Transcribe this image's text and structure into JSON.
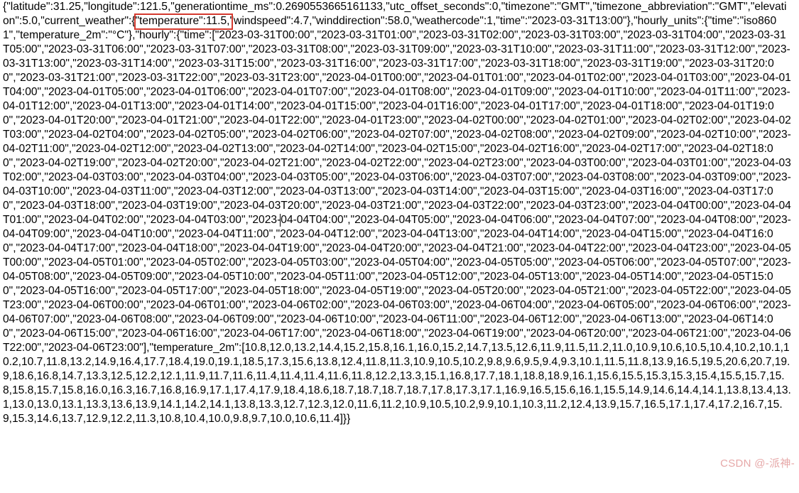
{
  "latitude": 31.25,
  "longitude": 121.5,
  "generationtime_ms": 0.2690553665161133,
  "utc_offset_seconds": 0,
  "timezone": "GMT",
  "timezone_abbreviation": "GMT",
  "elevation": 5.0,
  "current_weather": {
    "temperature": 11.5,
    "windspeed": 4.7,
    "winddirection": 58.0,
    "weathercode": 1,
    "time": "2023-03-31T13:00"
  },
  "hourly_units": {
    "time": "iso8601",
    "temperature_2m": "°C"
  },
  "hourly": {
    "time": [
      "2023-03-31T00:00",
      "2023-03-31T01:00",
      "2023-03-31T02:00",
      "2023-03-31T03:00",
      "2023-03-31T04:00",
      "2023-03-31T05:00",
      "2023-03-31T06:00",
      "2023-03-31T07:00",
      "2023-03-31T08:00",
      "2023-03-31T09:00",
      "2023-03-31T10:00",
      "2023-03-31T11:00",
      "2023-03-31T12:00",
      "2023-03-31T13:00",
      "2023-03-31T14:00",
      "2023-03-31T15:00",
      "2023-03-31T16:00",
      "2023-03-31T17:00",
      "2023-03-31T18:00",
      "2023-03-31T19:00",
      "2023-03-31T20:00",
      "2023-03-31T21:00",
      "2023-03-31T22:00",
      "2023-03-31T23:00",
      "2023-04-01T00:00",
      "2023-04-01T01:00",
      "2023-04-01T02:00",
      "2023-04-01T03:00",
      "2023-04-01T04:00",
      "2023-04-01T05:00",
      "2023-04-01T06:00",
      "2023-04-01T07:00",
      "2023-04-01T08:00",
      "2023-04-01T09:00",
      "2023-04-01T10:00",
      "2023-04-01T11:00",
      "2023-04-01T12:00",
      "2023-04-01T13:00",
      "2023-04-01T14:00",
      "2023-04-01T15:00",
      "2023-04-01T16:00",
      "2023-04-01T17:00",
      "2023-04-01T18:00",
      "2023-04-01T19:00",
      "2023-04-01T20:00",
      "2023-04-01T21:00",
      "2023-04-01T22:00",
      "2023-04-01T23:00",
      "2023-04-02T00:00",
      "2023-04-02T01:00",
      "2023-04-02T02:00",
      "2023-04-02T03:00",
      "2023-04-02T04:00",
      "2023-04-02T05:00",
      "2023-04-02T06:00",
      "2023-04-02T07:00",
      "2023-04-02T08:00",
      "2023-04-02T09:00",
      "2023-04-02T10:00",
      "2023-04-02T11:00",
      "2023-04-02T12:00",
      "2023-04-02T13:00",
      "2023-04-02T14:00",
      "2023-04-02T15:00",
      "2023-04-02T16:00",
      "2023-04-02T17:00",
      "2023-04-02T18:00",
      "2023-04-02T19:00",
      "2023-04-02T20:00",
      "2023-04-02T21:00",
      "2023-04-02T22:00",
      "2023-04-02T23:00",
      "2023-04-03T00:00",
      "2023-04-03T01:00",
      "2023-04-03T02:00",
      "2023-04-03T03:00",
      "2023-04-03T04:00",
      "2023-04-03T05:00",
      "2023-04-03T06:00",
      "2023-04-03T07:00",
      "2023-04-03T08:00",
      "2023-04-03T09:00",
      "2023-04-03T10:00",
      "2023-04-03T11:00",
      "2023-04-03T12:00",
      "2023-04-03T13:00",
      "2023-04-03T14:00",
      "2023-04-03T15:00",
      "2023-04-03T16:00",
      "2023-04-03T17:00",
      "2023-04-03T18:00",
      "2023-04-03T19:00",
      "2023-04-03T20:00",
      "2023-04-03T21:00",
      "2023-04-03T22:00",
      "2023-04-03T23:00",
      "2023-04-04T00:00",
      "2023-04-04T01:00",
      "2023-04-04T02:00",
      "2023-04-04T03:00",
      "2023-04-04T04:00",
      "2023-04-04T05:00",
      "2023-04-04T06:00",
      "2023-04-04T07:00",
      "2023-04-04T08:00",
      "2023-04-04T09:00",
      "2023-04-04T10:00",
      "2023-04-04T11:00",
      "2023-04-04T12:00",
      "2023-04-04T13:00",
      "2023-04-04T14:00",
      "2023-04-04T15:00",
      "2023-04-04T16:00",
      "2023-04-04T17:00",
      "2023-04-04T18:00",
      "2023-04-04T19:00",
      "2023-04-04T20:00",
      "2023-04-04T21:00",
      "2023-04-04T22:00",
      "2023-04-04T23:00",
      "2023-04-05T00:00",
      "2023-04-05T01:00",
      "2023-04-05T02:00",
      "2023-04-05T03:00",
      "2023-04-05T04:00",
      "2023-04-05T05:00",
      "2023-04-05T06:00",
      "2023-04-05T07:00",
      "2023-04-05T08:00",
      "2023-04-05T09:00",
      "2023-04-05T10:00",
      "2023-04-05T11:00",
      "2023-04-05T12:00",
      "2023-04-05T13:00",
      "2023-04-05T14:00",
      "2023-04-05T15:00",
      "2023-04-05T16:00",
      "2023-04-05T17:00",
      "2023-04-05T18:00",
      "2023-04-05T19:00",
      "2023-04-05T20:00",
      "2023-04-05T21:00",
      "2023-04-05T22:00",
      "2023-04-05T23:00",
      "2023-04-06T00:00",
      "2023-04-06T01:00",
      "2023-04-06T02:00",
      "2023-04-06T03:00",
      "2023-04-06T04:00",
      "2023-04-06T05:00",
      "2023-04-06T06:00",
      "2023-04-06T07:00",
      "2023-04-06T08:00",
      "2023-04-06T09:00",
      "2023-04-06T10:00",
      "2023-04-06T11:00",
      "2023-04-06T12:00",
      "2023-04-06T13:00",
      "2023-04-06T14:00",
      "2023-04-06T15:00",
      "2023-04-06T16:00",
      "2023-04-06T17:00",
      "2023-04-06T18:00",
      "2023-04-06T19:00",
      "2023-04-06T20:00",
      "2023-04-06T21:00",
      "2023-04-06T22:00",
      "2023-04-06T23:00"
    ],
    "temperature_2m": [
      10.8,
      12.0,
      13.2,
      14.4,
      15.2,
      15.8,
      16.1,
      16.0,
      15.2,
      14.7,
      13.5,
      12.6,
      11.9,
      11.5,
      11.2,
      11.0,
      10.9,
      10.6,
      10.5,
      10.4,
      10.2,
      10.1,
      10.2,
      10.7,
      11.8,
      13.2,
      14.9,
      16.4,
      17.7,
      18.4,
      19.0,
      19.1,
      18.5,
      17.3,
      15.6,
      13.8,
      12.4,
      11.8,
      11.3,
      10.9,
      10.5,
      10.2,
      9.8,
      9.6,
      9.5,
      9.4,
      9.3,
      10.1,
      11.5,
      11.8,
      13.9,
      16.5,
      19.5,
      20.6,
      20.7,
      19.9,
      18.6,
      16.8,
      14.7,
      13.3,
      12.5,
      12.2,
      12.1,
      11.9,
      11.7,
      11.6,
      11.4,
      11.4,
      11.4,
      11.6,
      11.8,
      12.2,
      13.3,
      15.1,
      16.8,
      17.7,
      18.1,
      18.8,
      18.9,
      16.1,
      15.6,
      15.5,
      15.3,
      15.3,
      15.4,
      15.5,
      15.7,
      15.8,
      15.8,
      15.7,
      15.8,
      16.0,
      16.3,
      16.7,
      16.8,
      16.9,
      17.1,
      17.4,
      17.9,
      18.4,
      18.6,
      18.7,
      18.7,
      18.7,
      18.7,
      17.8,
      17.3,
      17.1,
      16.9,
      16.5,
      15.6,
      16.1,
      15.5,
      14.9,
      14.6,
      14.4,
      14.1,
      13.8,
      13.4,
      13.1,
      13.0,
      13.0,
      13.1,
      13.3,
      13.6,
      13.9,
      14.1,
      14.2,
      14.1,
      13.8,
      13.3,
      12.7,
      12.3,
      12.0,
      11.6,
      11.2,
      10.9,
      10.5,
      10.2,
      9.9,
      10.1,
      10.3,
      11.2,
      12.4,
      13.9,
      15.7,
      16.5,
      17.1,
      17.4,
      17.2,
      16.7,
      15.9,
      15.3,
      14.6,
      13.7,
      12.9,
      12.2,
      11.3,
      10.8,
      10.4,
      10.0,
      9.8,
      9.7,
      10.0,
      10.6,
      11.4
    ]
  },
  "highlight_target": "\"temperature\":11.5,",
  "watermark": "CSDN @-派神-"
}
